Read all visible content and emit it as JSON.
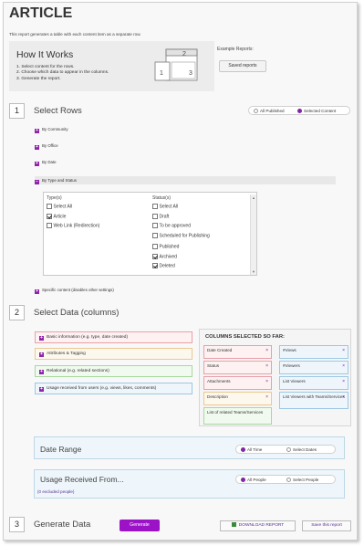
{
  "page": {
    "title": "ARTICLE",
    "description": "This report generates a table with each content item as a separate row."
  },
  "how_it_works": {
    "heading": "How It Works",
    "steps": [
      "1. Select content for the rows.",
      "2. Choose which data to appear in the columns.",
      "3. Generate the report."
    ],
    "diagram_numbers": [
      "1",
      "2",
      "3"
    ]
  },
  "example_reports": {
    "label": "Example Reports:",
    "button": "Saved reports"
  },
  "select_rows": {
    "number": "1",
    "title": "Select Rows",
    "options": [
      "All Published",
      "Selected Content"
    ],
    "selected": "Selected Content",
    "filters": [
      {
        "label": "By Community",
        "state": "collapsed"
      },
      {
        "label": "By Office",
        "state": "collapsed"
      },
      {
        "label": "By Date",
        "state": "collapsed"
      },
      {
        "label": "By Type and Status",
        "state": "expanded"
      }
    ],
    "types_header": "Type(s)",
    "types": [
      {
        "label": "Select All",
        "checked": false
      },
      {
        "label": "Article",
        "checked": true
      },
      {
        "label": "Web Link (Redirection)",
        "checked": false
      }
    ],
    "status_header": "Status(s)",
    "statuses": [
      {
        "label": "Select All",
        "checked": false
      },
      {
        "label": "Draft",
        "checked": false
      },
      {
        "label": "To be approved",
        "checked": false
      },
      {
        "label": "Scheduled for Publishing",
        "checked": false
      },
      {
        "label": "Published",
        "checked": false
      },
      {
        "label": "Archived",
        "checked": true
      },
      {
        "label": "Deleted",
        "checked": true
      }
    ],
    "specific_content": "Specific content (disables other settings)"
  },
  "select_data": {
    "number": "2",
    "title": "Select Data (columns)",
    "groups": [
      {
        "label": "Basic information (e.g. type, date created)",
        "border": "#e8a0a8",
        "bg": "#fdf1f2"
      },
      {
        "label": "Attributes & Tagging",
        "border": "#ecc890",
        "bg": "#fdf8ee"
      },
      {
        "label": "Relational (e.g. related sections)",
        "border": "#a8d8a0",
        "bg": "#f1faef"
      },
      {
        "label": "Usage received from users (e.g. views, likes, comments)",
        "border": "#9cc8e4",
        "bg": "#eef6fc"
      }
    ],
    "columns_heading": "COLUMNS SELECTED SO FAR:",
    "columns_left": [
      {
        "label": "Date Created",
        "border": "#e8a0a8",
        "bg": "#fdf1f2"
      },
      {
        "label": "Status",
        "border": "#e8a0a8",
        "bg": "#fdf1f2"
      },
      {
        "label": "Attachments",
        "border": "#e8a0a8",
        "bg": "#fdf1f2"
      },
      {
        "label": "Description",
        "border": "#ecc890",
        "bg": "#fdf8ee"
      },
      {
        "label": "List of related Teams/Services",
        "border": "#a8d8a0",
        "bg": "#f1faef"
      }
    ],
    "columns_right": [
      {
        "label": "#Views",
        "border": "#9cc8e4",
        "bg": "#eef6fc"
      },
      {
        "label": "#Viewers",
        "border": "#9cc8e4",
        "bg": "#eef6fc"
      },
      {
        "label": "List Viewers",
        "border": "#9cc8e4",
        "bg": "#eef6fc"
      },
      {
        "label": "List Viewers with Teams/Services",
        "border": "#9cc8e4",
        "bg": "#eef6fc"
      }
    ],
    "remove_glyph": "×"
  },
  "date_range": {
    "title": "Date Range",
    "options": [
      "All Time",
      "Select Dates"
    ],
    "selected": "All Time"
  },
  "usage": {
    "title": "Usage Received From...",
    "options": [
      "All People",
      "Select People"
    ],
    "selected": "All People",
    "excluded": "(0 excluded people)"
  },
  "generate": {
    "number": "3",
    "title": "Generate Data",
    "button": "Generate",
    "download": "DOWNLOAD REPORT",
    "save": "Save this report"
  },
  "colors": {
    "accent": "#8e24aa",
    "generate_bg": "#9b12c7"
  }
}
